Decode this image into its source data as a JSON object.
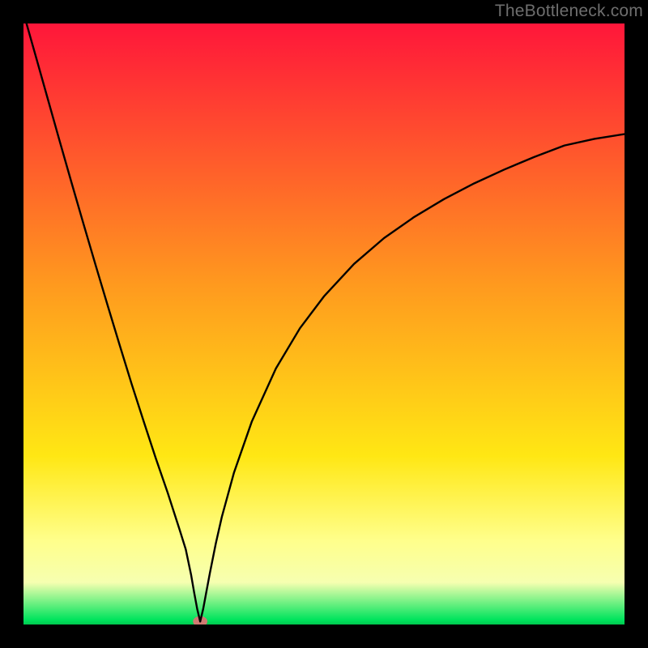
{
  "watermark": "TheBottleneck.com",
  "chart_data": {
    "type": "line",
    "title": "",
    "xlabel": "",
    "ylabel": "",
    "xlim": [
      0,
      100
    ],
    "ylim": [
      0,
      100
    ],
    "grid": false,
    "colors": {
      "gradient_top": "#ff163a",
      "gradient_upper_mid": "#ff9b1e",
      "gradient_mid": "#ffe714",
      "gradient_lower": "#ffff8b",
      "gradient_bottom": "#00e45d",
      "curve": "#000000",
      "marker_fill": "#cf7a72",
      "frame": "#000000"
    },
    "series": [
      {
        "name": "bottleneck-curve",
        "type": "line",
        "x": [
          0.5,
          2,
          4,
          6,
          8,
          10,
          12,
          14,
          16,
          18,
          20,
          22,
          24,
          26,
          27,
          27.9,
          28.4,
          28.9,
          29.4,
          29.9,
          30.4,
          31,
          32,
          33,
          35,
          38,
          42,
          46,
          50,
          55,
          60,
          65,
          70,
          75,
          80,
          85,
          90,
          95,
          100
        ],
        "y": [
          100,
          94.7,
          87.6,
          80.5,
          73.5,
          66.6,
          59.8,
          53.1,
          46.5,
          40.0,
          33.8,
          27.7,
          21.9,
          15.7,
          12.5,
          8.2,
          5.3,
          2.6,
          0.5,
          2.6,
          5.3,
          8.5,
          13.5,
          17.9,
          25.2,
          33.8,
          42.6,
          49.3,
          54.6,
          60.0,
          64.3,
          67.8,
          70.8,
          73.4,
          75.7,
          77.8,
          79.7,
          80.8,
          81.6
        ]
      }
    ],
    "marker": {
      "x": 29.4,
      "y": 0.5,
      "rx": 1.2,
      "ry": 0.9
    }
  }
}
